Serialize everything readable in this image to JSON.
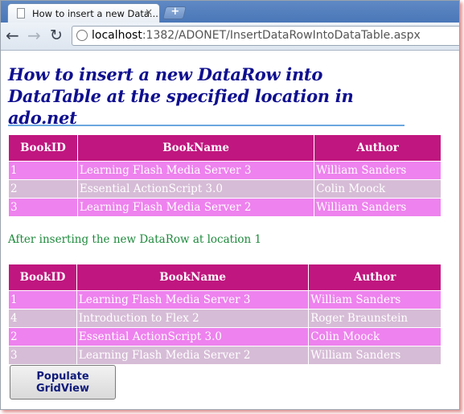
{
  "browser": {
    "tab_title": "How to insert a new Data...",
    "close_glyph": "×",
    "newtab_glyph": "+",
    "url_host": "localhost",
    "url_path": ":1382/ADONET/InsertDataRowIntoDataTable.aspx"
  },
  "page": {
    "heading_line1": "How to insert a new DataRow into",
    "heading_line2": "DataTable at the specified location in ado.net",
    "note": "After inserting the new DataRow at location 1",
    "button_label": "Populate GridView"
  },
  "colors": {
    "header_bg": "#c0167f",
    "odd_row": "#ee82ee",
    "even_row": "#d6bcd6",
    "heading": "#0f0f8f",
    "note": "#1e8a3c"
  },
  "table1": {
    "headers": [
      "BookID",
      "BookName",
      "Author"
    ],
    "rows": [
      [
        "1",
        "Learning Flash Media Server 3",
        "William Sanders"
      ],
      [
        "2",
        "Essential ActionScript 3.0",
        "Colin Moock"
      ],
      [
        "3",
        "Learning Flash Media Server 2",
        "William Sanders"
      ]
    ]
  },
  "table2": {
    "headers": [
      "BookID",
      "BookName",
      "Author"
    ],
    "rows": [
      [
        "1",
        "Learning Flash Media Server 3",
        "William Sanders"
      ],
      [
        "4",
        "Introduction to Flex 2",
        "Roger Braunstein"
      ],
      [
        "2",
        "Essential ActionScript 3.0",
        "Colin Moock"
      ],
      [
        "3",
        "Learning Flash Media Server 2",
        "William Sanders"
      ]
    ]
  }
}
